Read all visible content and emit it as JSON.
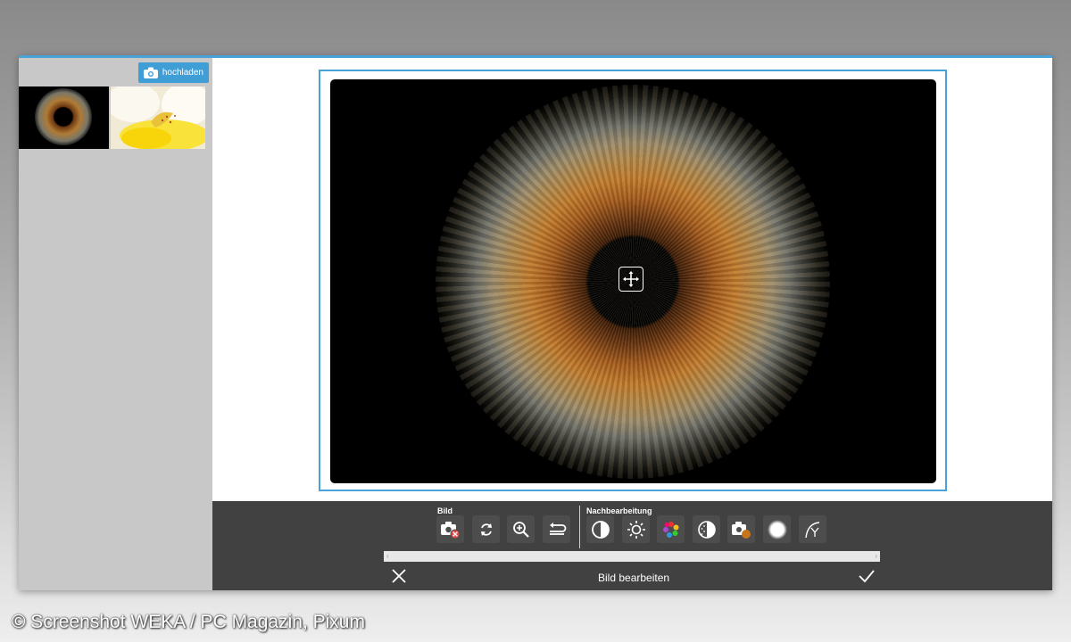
{
  "sidebar": {
    "upload_label": "hochladen",
    "thumbnails": [
      {
        "name": "iris-thumbnail"
      },
      {
        "name": "flower-thumbnail"
      }
    ]
  },
  "toolbar": {
    "group_bild": "Bild",
    "group_nachbearbeitung": "Nachbearbeitung",
    "bild_tools": [
      "delete-image",
      "rotate",
      "zoom",
      "undo"
    ],
    "nach_tools": [
      "contrast",
      "brightness",
      "color",
      "sharpness",
      "effect",
      "vignette",
      "curve"
    ],
    "title": "Bild bearbeiten",
    "scroll_left": "‹",
    "scroll_right": "›"
  },
  "colors": {
    "accent": "#4aa3d8",
    "toolbar_bg": "#414141",
    "sidebar_bg": "#c8c8c8"
  },
  "credit": "© Screenshot WEKA / PC Magazin, Pixum"
}
